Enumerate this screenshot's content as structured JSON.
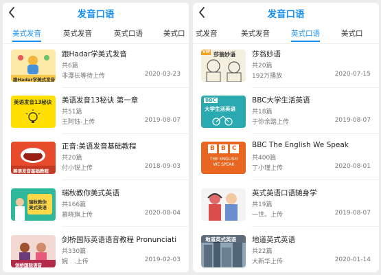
{
  "left": {
    "title": "发音口语",
    "tabs": [
      "美式发音",
      "英式发音",
      "英式口语",
      "美式口"
    ],
    "active_tab": 0,
    "items": [
      {
        "title": "跟Hadar学美式发音",
        "count": "共6篇",
        "uploader": "非瀑长等待上传",
        "date": "2020-03-23",
        "thumb_text": "跟Hadar学美式发音"
      },
      {
        "title": "美语发音13秘诀 第一章",
        "count": "共51篇",
        "uploader": "王阿钰-上传",
        "date": "2019-08-07",
        "thumb_text": "美语发音13秘诀"
      },
      {
        "title": "正音:美语发音基础教程",
        "count": "共20篇",
        "uploader": "付小锐上传",
        "date": "2018-09-03",
        "thumb_text": "美语发音基础教程"
      },
      {
        "title": "瑞秋教你美式英语",
        "count": "共166篇",
        "uploader": "慕晓旗上传",
        "date": "2020-08-04",
        "thumb_text": "瑞秋教你美式英语"
      },
      {
        "title": "剑桥国际英语语音教程 Pronunciati",
        "count": "共330篇",
        "uploader": "婉　.上传",
        "date": "2019-02-03",
        "thumb_text": "剑桥国际语音"
      }
    ]
  },
  "right": {
    "title": "发音口语",
    "tabs": [
      "式发音",
      "美式发音",
      "英式口语",
      "美式口"
    ],
    "active_tab": 2,
    "items": [
      {
        "title": "莎翁妙语",
        "count": "共20篇",
        "uploader": "192万播放",
        "date": "2020-07-15",
        "thumb_text": "莎翁妙语",
        "thumb_badge": "VIP"
      },
      {
        "title": "BBC大学生活英语",
        "count": "共18篇",
        "uploader": "于你余踏上传",
        "date": "2019-08-07",
        "thumb_text": "大学生活英语",
        "thumb_badge": "BBC"
      },
      {
        "title": "BBC The English We Speak",
        "count": "共400篇",
        "uploader": "丁小瑾上传",
        "date": "2020-08-01",
        "thumb_text": "THE ENGLISH WE SPEAK",
        "thumb_badge": "BBC"
      },
      {
        "title": "英式英语口语随身学",
        "count": "共19篇",
        "uploader": "一世。上传",
        "date": "2019-08-07"
      },
      {
        "title": "地道英式英语",
        "count": "共22篇",
        "uploader": "大新华上传",
        "date": "2020-01-14",
        "thumb_text": "地道英式英语"
      }
    ]
  },
  "colors": {
    "accent": "#1790f0",
    "text": "#222222",
    "muted": "#777777",
    "bbc_orange": "#e8661f",
    "bbc_teal": "#2aa9b0"
  }
}
